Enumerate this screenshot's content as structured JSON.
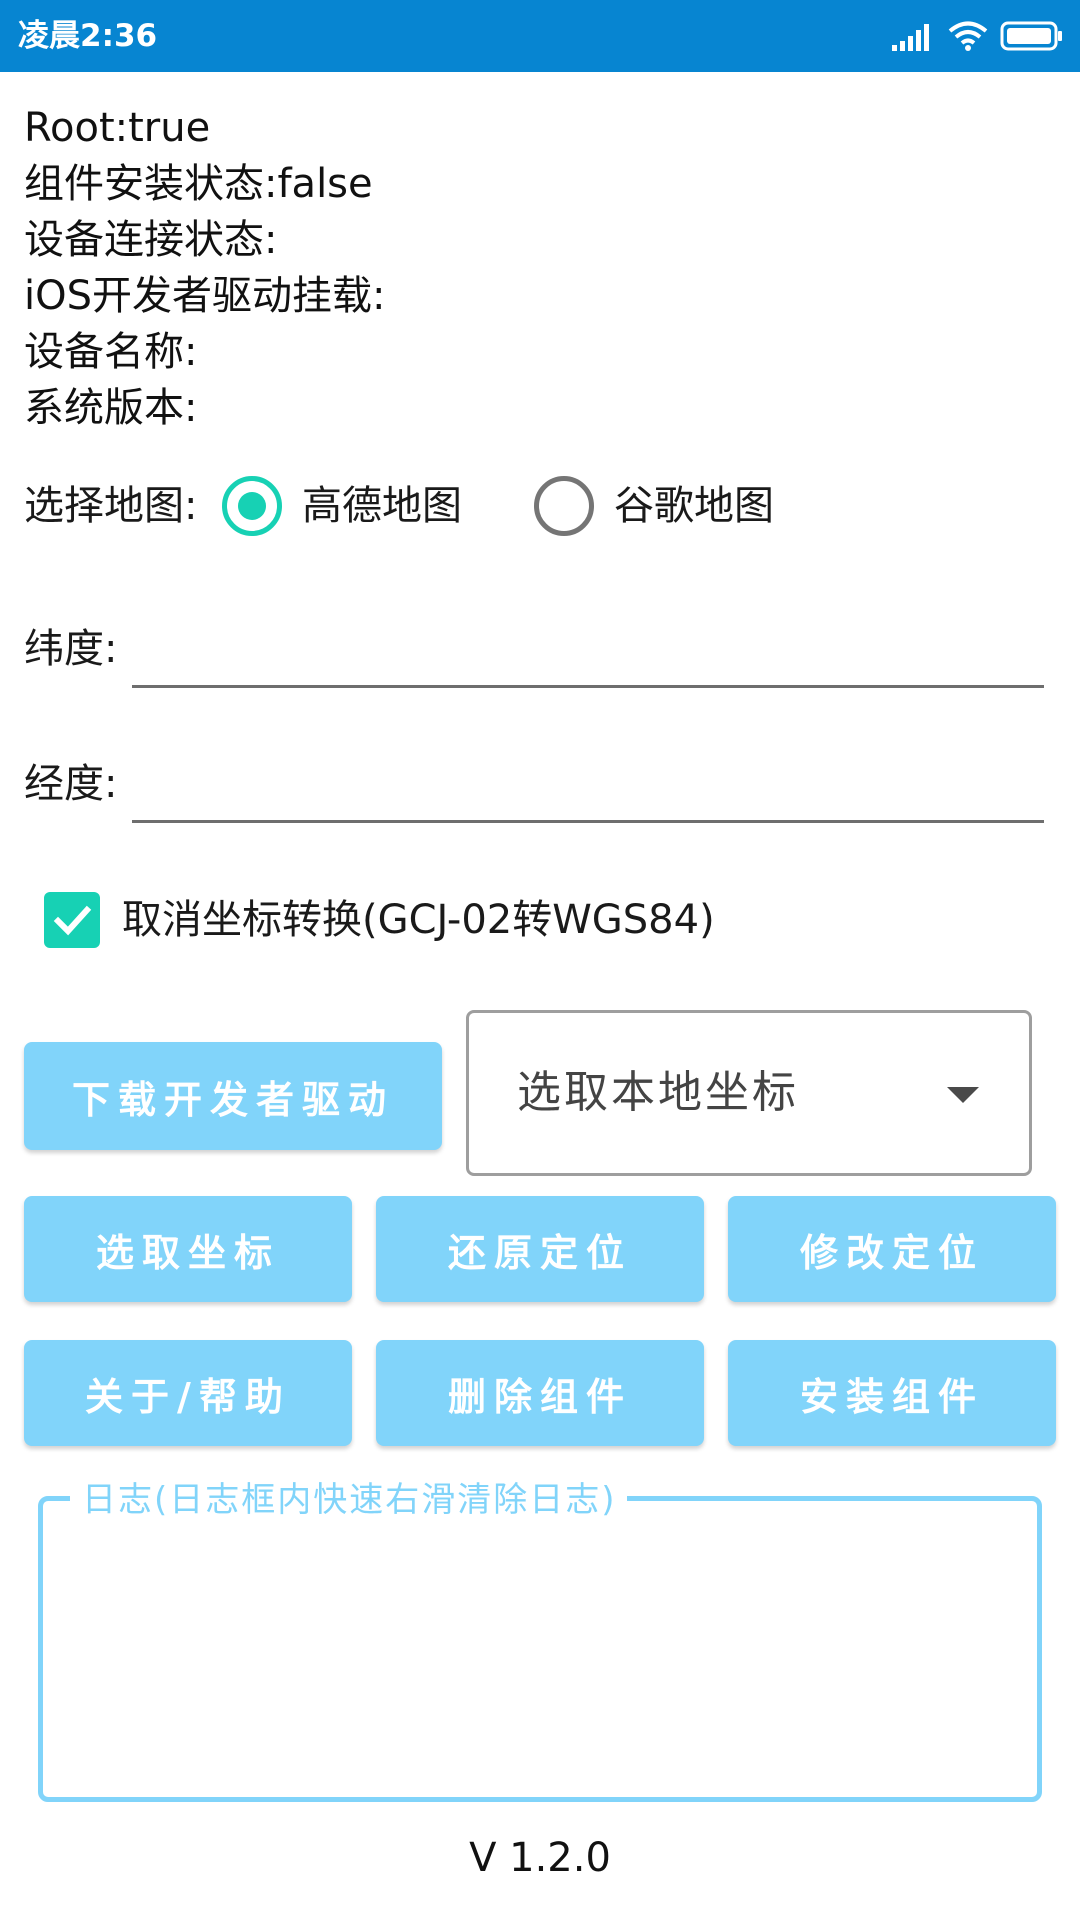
{
  "status_bar": {
    "time": "凌晨2:36",
    "icons": [
      "signal-icon",
      "wifi-icon",
      "battery-icon"
    ],
    "color": "#0785d1"
  },
  "info": {
    "root": "Root:true",
    "component_status": "组件安装状态:false",
    "device_connection": "设备连接状态:",
    "ios_driver_mount": "iOS开发者驱动挂载:",
    "device_name": "设备名称:",
    "system_version": "系统版本:"
  },
  "map_select": {
    "label": "选择地图:",
    "options": [
      {
        "label": "高德地图",
        "selected": true
      },
      {
        "label": "谷歌地图",
        "selected": false
      }
    ]
  },
  "fields": {
    "latitude_label": "纬度:",
    "latitude_value": "",
    "longitude_label": "经度:",
    "longitude_value": ""
  },
  "checkbox": {
    "label": "取消坐标转换(GCJ-02转WGS84)",
    "checked": true
  },
  "buttons": {
    "download_driver": "下载开发者驱动",
    "pick_coordinates": "选取坐标",
    "restore_location": "还原定位",
    "modify_location": "修改定位",
    "about_help": "关于/帮助",
    "delete_component": "删除组件",
    "install_component": "安装组件"
  },
  "dropdown": {
    "value": "选取本地坐标"
  },
  "log": {
    "title": "日志(日志框内快速右滑清除日志)",
    "content": ""
  },
  "version": "V 1.2.0",
  "colors": {
    "accent": "#17d1b4",
    "button": "#81d4fa",
    "button_text": "#ffffff"
  }
}
